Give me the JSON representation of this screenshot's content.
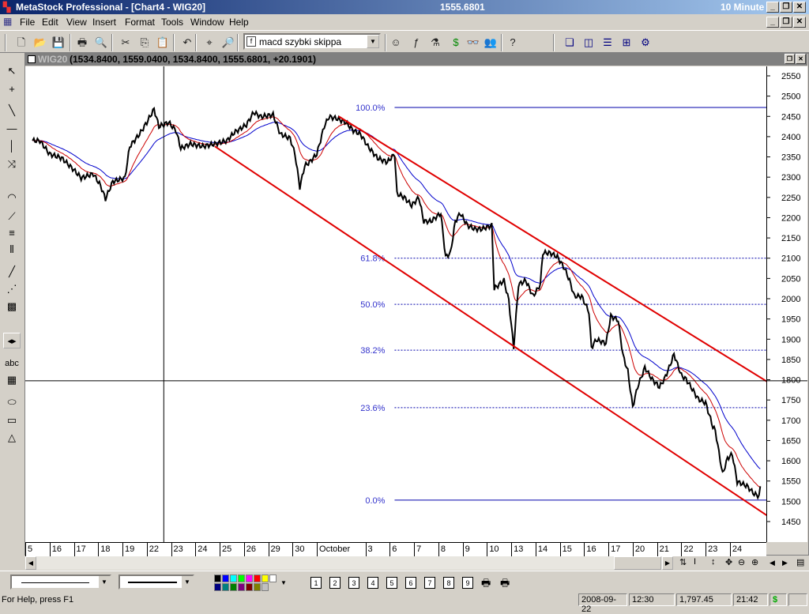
{
  "app": {
    "title": "MetaStock Professional - [Chart4 - WIG20]",
    "last_price": "1555.6801",
    "interval": "10 Minute"
  },
  "menu": [
    "File",
    "Edit",
    "View",
    "Insert",
    "Format",
    "Tools",
    "Window",
    "Help"
  ],
  "toolbar": {
    "buttons": [
      "new-icon",
      "open-icon",
      "save-icon",
      "print-icon",
      "print-preview-icon",
      "cut-icon",
      "copy-icon",
      "paste-icon",
      "undo-icon",
      "crosshair-icon",
      "zoom-icon",
      "expert-icon",
      "formula-icon",
      "explorer-icon",
      "dollar-icon",
      "binoculars-icon",
      "users-icon",
      "help-pointer-icon",
      "cascade-icon",
      "tile-vertical-icon",
      "tile-horizontal-icon",
      "tile-grid-icon",
      "settings-icon"
    ],
    "indicator_combo": "macd szybki skippa"
  },
  "chart_window": {
    "symbol": "WIG20",
    "ohlc": "(1534.8400, 1559.0400, 1534.8400, 1555.6801, +20.1901)"
  },
  "left_tools": [
    "pointer-icon",
    "crosshair-icon",
    "trendline-icon",
    "horizontal-line-icon",
    "vertical-line-icon",
    "cycle-icon",
    "arc-icon",
    "fan-icon",
    "fib-retracement-icon",
    "time-zones-icon",
    "channel-icon",
    "gann-icon",
    "speed-lines-icon",
    "text-icon",
    "grid-icon",
    "ellipse-icon",
    "rectangle-icon",
    "triangle-icon"
  ],
  "left_text_tool": "abc",
  "chart_data": {
    "type": "line",
    "series_name": "WIG20",
    "y_ticks": [
      2550,
      2500,
      2450,
      2400,
      2350,
      2300,
      2250,
      2200,
      2150,
      2100,
      2050,
      2000,
      1950,
      1900,
      1850,
      1800,
      1750,
      1700,
      1650,
      1600,
      1550,
      1500,
      1450
    ],
    "ylim": [
      1450,
      2550
    ],
    "x_labels": [
      {
        "day": 0,
        "label": "5"
      },
      {
        "day": 1,
        "label": "16"
      },
      {
        "day": 2,
        "label": "17"
      },
      {
        "day": 3,
        "label": "18"
      },
      {
        "day": 4,
        "label": "19"
      },
      {
        "day": 5,
        "label": "22"
      },
      {
        "day": 6,
        "label": "23"
      },
      {
        "day": 7,
        "label": "24"
      },
      {
        "day": 8,
        "label": "25"
      },
      {
        "day": 9,
        "label": "26"
      },
      {
        "day": 10,
        "label": "29"
      },
      {
        "day": 11,
        "label": "30"
      },
      {
        "day": 12,
        "label": "October"
      },
      {
        "day": 14,
        "label": "3"
      },
      {
        "day": 15,
        "label": "6"
      },
      {
        "day": 16,
        "label": "7"
      },
      {
        "day": 17,
        "label": "8"
      },
      {
        "day": 18,
        "label": "9"
      },
      {
        "day": 19,
        "label": "10"
      },
      {
        "day": 20,
        "label": "13"
      },
      {
        "day": 21,
        "label": "14"
      },
      {
        "day": 22,
        "label": "15"
      },
      {
        "day": 23,
        "label": "16"
      },
      {
        "day": 24,
        "label": "17"
      },
      {
        "day": 25,
        "label": "20"
      },
      {
        "day": 26,
        "label": "21"
      },
      {
        "day": 27,
        "label": "22"
      },
      {
        "day": 28,
        "label": "23"
      },
      {
        "day": 29,
        "label": "24"
      }
    ],
    "xlim": [
      -0.3,
      30.2
    ],
    "price": [
      [
        0,
        2390
      ],
      [
        0.3,
        2390
      ],
      [
        0.7,
        2357
      ],
      [
        1.2,
        2347
      ],
      [
        1.7,
        2318
      ],
      [
        2.0,
        2298
      ],
      [
        2.5,
        2308
      ],
      [
        2.8,
        2279
      ],
      [
        3.0,
        2246
      ],
      [
        3.3,
        2289
      ],
      [
        3.8,
        2298
      ],
      [
        4.0,
        2376
      ],
      [
        4.4,
        2406
      ],
      [
        4.7,
        2435
      ],
      [
        5.0,
        2468
      ],
      [
        5.2,
        2425
      ],
      [
        5.6,
        2435
      ],
      [
        5.9,
        2415
      ],
      [
        6.1,
        2371
      ],
      [
        6.5,
        2382
      ],
      [
        7.0,
        2376
      ],
      [
        7.5,
        2382
      ],
      [
        8.0,
        2390
      ],
      [
        8.3,
        2410
      ],
      [
        8.8,
        2429
      ],
      [
        9.1,
        2460
      ],
      [
        9.4,
        2449
      ],
      [
        9.9,
        2454
      ],
      [
        10.2,
        2406
      ],
      [
        10.6,
        2396
      ],
      [
        10.8,
        2357
      ],
      [
        11.0,
        2275
      ],
      [
        11.2,
        2328
      ],
      [
        11.4,
        2337
      ],
      [
        11.7,
        2357
      ],
      [
        12.0,
        2425
      ],
      [
        12.2,
        2449
      ],
      [
        12.5,
        2445
      ],
      [
        12.9,
        2435
      ],
      [
        13.2,
        2415
      ],
      [
        13.5,
        2406
      ],
      [
        13.8,
        2376
      ],
      [
        14.2,
        2347
      ],
      [
        14.6,
        2337
      ],
      [
        14.9,
        2357
      ],
      [
        15.0,
        2259
      ],
      [
        15.3,
        2250
      ],
      [
        15.6,
        2230
      ],
      [
        15.9,
        2250
      ],
      [
        16.1,
        2191
      ],
      [
        16.4,
        2191
      ],
      [
        16.8,
        2211
      ],
      [
        17.0,
        2103
      ],
      [
        17.2,
        2113
      ],
      [
        17.4,
        2191
      ],
      [
        17.6,
        2211
      ],
      [
        17.9,
        2181
      ],
      [
        18.2,
        2172
      ],
      [
        18.5,
        2172
      ],
      [
        18.9,
        2181
      ],
      [
        19.0,
        2025
      ],
      [
        19.4,
        2045
      ],
      [
        19.6,
        1996
      ],
      [
        19.8,
        1879
      ],
      [
        20.0,
        2035
      ],
      [
        20.3,
        2045
      ],
      [
        20.6,
        2006
      ],
      [
        20.9,
        2035
      ],
      [
        21.0,
        2113
      ],
      [
        21.3,
        2113
      ],
      [
        21.6,
        2103
      ],
      [
        21.9,
        2074
      ],
      [
        22.1,
        2045
      ],
      [
        22.3,
        2006
      ],
      [
        22.6,
        2006
      ],
      [
        22.9,
        1967
      ],
      [
        23.0,
        1879
      ],
      [
        23.2,
        1899
      ],
      [
        23.6,
        1890
      ],
      [
        23.8,
        1957
      ],
      [
        24.1,
        1947
      ],
      [
        24.3,
        1860
      ],
      [
        24.5,
        1821
      ],
      [
        24.7,
        1733
      ],
      [
        24.9,
        1782
      ],
      [
        25.2,
        1830
      ],
      [
        25.5,
        1801
      ],
      [
        25.8,
        1782
      ],
      [
        26.0,
        1801
      ],
      [
        26.2,
        1830
      ],
      [
        26.4,
        1863
      ],
      [
        26.7,
        1811
      ],
      [
        26.9,
        1801
      ],
      [
        27.1,
        1782
      ],
      [
        27.4,
        1752
      ],
      [
        27.7,
        1743
      ],
      [
        28.0,
        1684
      ],
      [
        28.1,
        1674
      ],
      [
        28.4,
        1567
      ],
      [
        28.6,
        1606
      ],
      [
        28.8,
        1616
      ],
      [
        29.0,
        1548
      ],
      [
        29.4,
        1538
      ],
      [
        29.7,
        1518
      ],
      [
        29.9,
        1513
      ],
      [
        30.0,
        1552
      ]
    ],
    "fib_levels": [
      {
        "label": "100.0%",
        "value": 2472
      },
      {
        "label": "61.8%",
        "value": 2100
      },
      {
        "label": "50.0%",
        "value": 1986
      },
      {
        "label": "38.2%",
        "value": 1873
      },
      {
        "label": "23.6%",
        "value": 1731
      },
      {
        "label": "0.0%",
        "value": 1503
      }
    ],
    "fib_start_day": 14.9,
    "channel_lines": [
      [
        [
          7.5,
          2376
        ],
        [
          30.7,
          1446
        ]
      ],
      [
        [
          12.6,
          2450
        ],
        [
          30.7,
          1778
        ]
      ]
    ],
    "crosshair": {
      "day": 5.4,
      "value": 1797.45
    },
    "colors": {
      "price": "#000000",
      "ma_fast": "#cc0000",
      "ma_slow": "#0000cc",
      "channel": "#e00000",
      "fib": "#0000aa"
    }
  },
  "bottom": {
    "line_styles": [
      "thin-line",
      "thick-line"
    ],
    "colors": [
      "#000000",
      "#0000ff",
      "#00ffff",
      "#00ff00",
      "#ff00ff",
      "#ff0000",
      "#ffff00",
      "#ffffff",
      "#000080",
      "#008080",
      "#008000",
      "#800080",
      "#800000",
      "#808000",
      "#c0c0c0"
    ],
    "chart_buttons": [
      "1",
      "2",
      "3",
      "4",
      "5",
      "6",
      "7",
      "8",
      "9"
    ]
  },
  "status": {
    "help": "For Help, press F1",
    "date": "2008-09-22",
    "time": "12:30",
    "value": "1,797.45",
    "clock": "21:42",
    "dollar": "$"
  }
}
